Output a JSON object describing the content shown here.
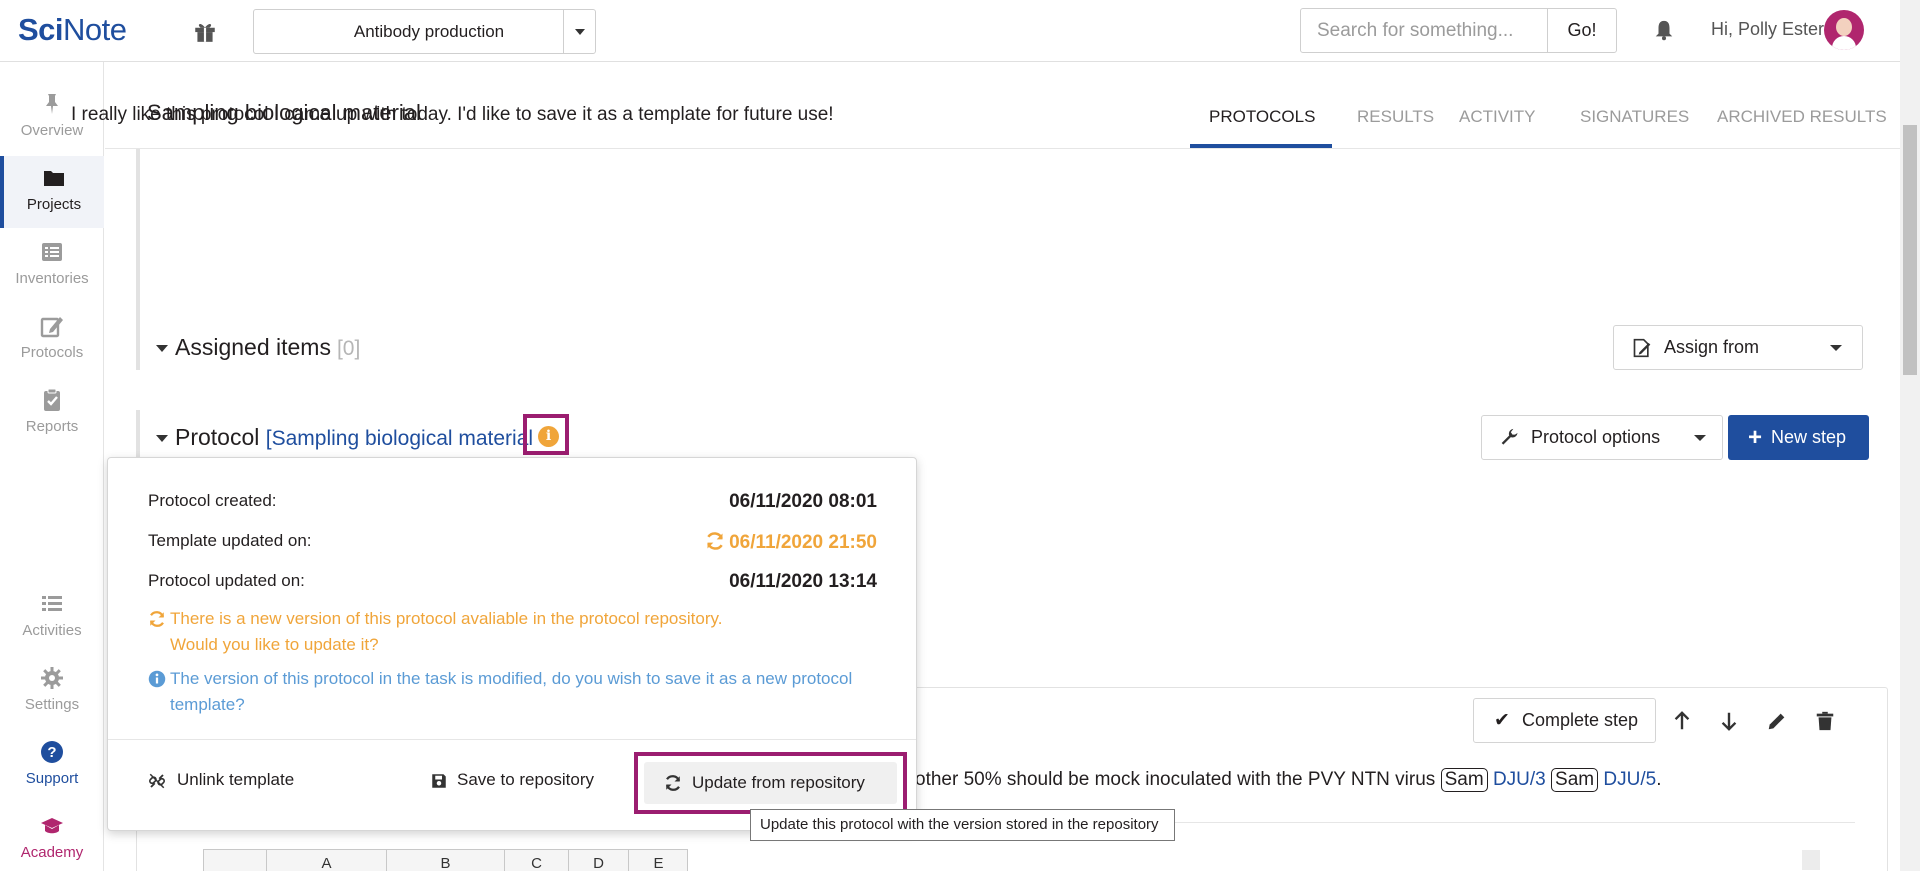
{
  "header": {
    "logo_sci": "Sci",
    "logo_note": "Note",
    "experiment_select": "Antibody production",
    "search_placeholder": "Search for something...",
    "go_label": "Go!",
    "greeting": "Hi, Polly Ester"
  },
  "leftnav": {
    "items": [
      {
        "label": "Overview",
        "icon": "pin-icon"
      },
      {
        "label": "Projects",
        "icon": "folder-icon"
      },
      {
        "label": "Inventories",
        "icon": "list-icon"
      },
      {
        "label": "Protocols",
        "icon": "edit-icon"
      },
      {
        "label": "Reports",
        "icon": "clipboard-icon"
      }
    ],
    "bottom_items": [
      {
        "label": "Activities",
        "icon": "activities-icon"
      },
      {
        "label": "Settings",
        "icon": "gear-icon"
      },
      {
        "label": "Support",
        "icon": "help-icon"
      },
      {
        "label": "Academy",
        "icon": "graduation-icon"
      }
    ],
    "active": "Projects"
  },
  "main": {
    "task_title": "Sampling biological material",
    "tabs": [
      "PROTOCOLS",
      "RESULTS",
      "ACTIVITY",
      "SIGNATURES",
      "ARCHIVED RESULTS"
    ],
    "active_tab": "PROTOCOLS",
    "description": "I really like this protocol I came up with today. I'd like to save it as a template for future use!",
    "assigned_items_title": "Assigned items",
    "assigned_items_count": "[0]",
    "assign_from_label": "Assign from",
    "protocol_label": "Protocol",
    "protocol_link": "[Sampling biological material",
    "protocol_options_label": "Protocol options",
    "new_step_label": "New step",
    "complete_step_label": "Complete step",
    "step_text_prefix": "other 50% should be mock inoculated with the PVY NTN virus",
    "step_tag_1": "Sam",
    "step_link_1": "DJU/3",
    "step_tag_2": "Sam",
    "step_link_2": "DJU/5",
    "step_suffix": ".",
    "sheet_columns": [
      "A",
      "B",
      "C",
      "D",
      "E"
    ]
  },
  "popover": {
    "created_label": "Protocol created:",
    "created_value": "06/11/2020 08:01",
    "template_updated_label": "Template updated on:",
    "template_updated_value": "06/11/2020 21:50",
    "protocol_updated_label": "Protocol updated on:",
    "protocol_updated_value": "06/11/2020 13:14",
    "new_version_msg_1": "There is a new version of this protocol avaliable in the protocol repository.",
    "new_version_msg_2": "Would you like to update it?",
    "modified_msg_1": "The version of this protocol in the task is modified, do you wish to save it as a new protocol",
    "modified_msg_2": "template?",
    "unlink_label": "Unlink template",
    "save_label": "Save to repository",
    "update_label": "Update from repository",
    "tooltip": "Update this protocol with the version stored in the repository"
  },
  "colors": {
    "brand": "#1f4e9e",
    "warning": "#f0a53a",
    "info": "#5b9bd5",
    "highlight": "#9b1d70",
    "academy": "#b0266e"
  }
}
